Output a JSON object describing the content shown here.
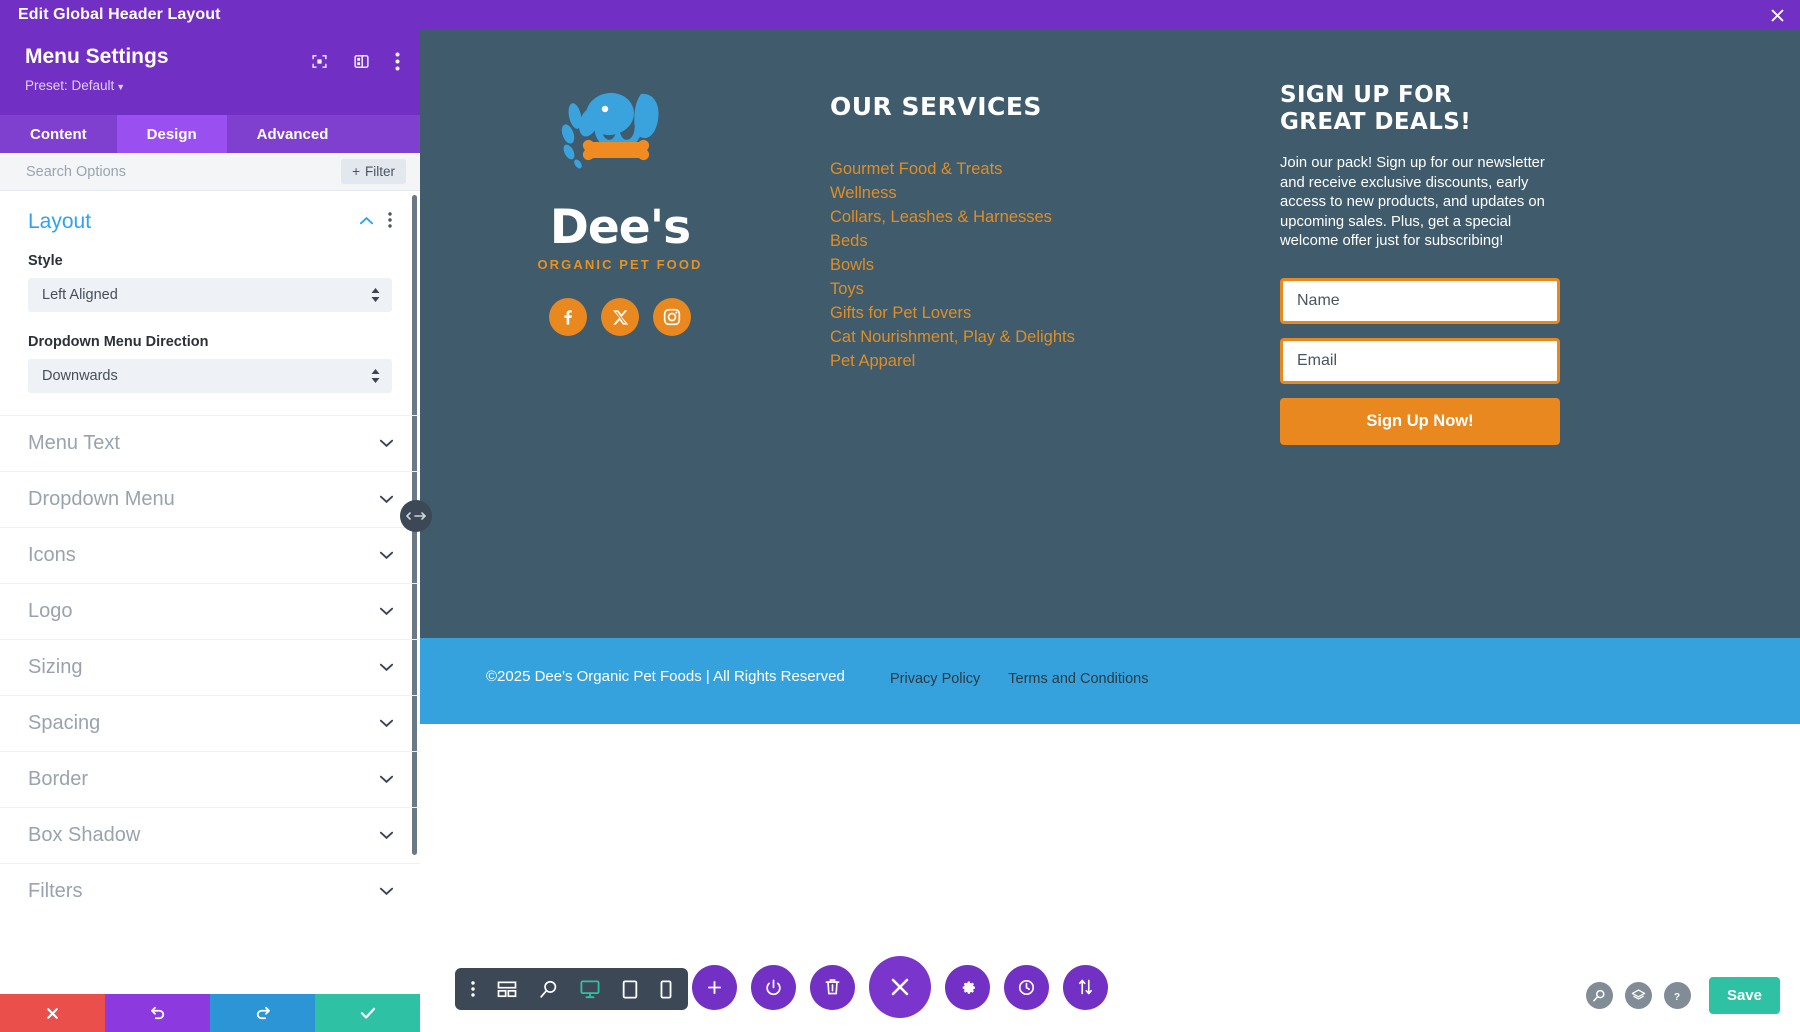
{
  "titlebar": {
    "text": "Edit Global Header Layout",
    "close_icon": "close-icon"
  },
  "panel": {
    "title": "Menu Settings",
    "preset": "Preset: Default",
    "header_icons": [
      "focus-target-icon",
      "panel-layout-icon",
      "more-vertical-icon"
    ],
    "tabs": [
      {
        "label": "Content",
        "active": false
      },
      {
        "label": "Design",
        "active": true
      },
      {
        "label": "Advanced",
        "active": false
      }
    ],
    "search_placeholder": "Search Options",
    "search_value": "",
    "filter_label": "Filter",
    "open_section": {
      "title": "Layout",
      "fields": [
        {
          "label": "Style",
          "value": "Left Aligned"
        },
        {
          "label": "Dropdown Menu Direction",
          "value": "Downwards"
        }
      ]
    },
    "sections": [
      {
        "label": "Menu Text"
      },
      {
        "label": "Dropdown Menu"
      },
      {
        "label": "Icons"
      },
      {
        "label": "Logo"
      },
      {
        "label": "Sizing"
      },
      {
        "label": "Spacing"
      },
      {
        "label": "Border"
      },
      {
        "label": "Box Shadow"
      },
      {
        "label": "Filters"
      }
    ],
    "actions": [
      {
        "name": "cancel-button",
        "icon": "close-icon",
        "color": "#eb4f4b"
      },
      {
        "name": "undo-button",
        "icon": "undo-icon",
        "color": "#8c3ae0"
      },
      {
        "name": "redo-button",
        "icon": "redo-icon",
        "color": "#2b95d6"
      },
      {
        "name": "confirm-button",
        "icon": "check-icon",
        "color": "#2fc1a3"
      }
    ]
  },
  "site": {
    "brand": {
      "word": "Dee's",
      "tagline": "ORGANIC PET FOOD"
    },
    "socials": [
      {
        "name": "facebook-icon"
      },
      {
        "name": "x-twitter-icon"
      },
      {
        "name": "instagram-icon"
      }
    ],
    "services": {
      "heading": "OUR SERVICES",
      "items": [
        "Gourmet Food & Treats",
        "Wellness",
        "Collars, Leashes & Harnesses",
        "Beds",
        "Bowls",
        "Toys",
        "Gifts for Pet Lovers",
        "Cat Nourishment, Play & Delights",
        "Pet Apparel"
      ]
    },
    "signup": {
      "heading": "SIGN UP FOR GREAT DEALS!",
      "body": "Join our pack! Sign up for our newsletter and receive exclusive discounts, early access to new products, and updates on upcoming sales. Plus, get a special welcome offer just for subscribing!",
      "name_placeholder": "Name",
      "name_value": "",
      "email_placeholder": "Email",
      "email_value": "",
      "submit_label": "Sign Up Now!"
    },
    "bottom": {
      "copyright": "©2025 Dee's Organic Pet Foods | All Rights Reserved",
      "links": [
        "Privacy Policy",
        "Terms and Conditions"
      ]
    }
  },
  "builder": {
    "left_tools": [
      {
        "name": "more-vertical-icon"
      },
      {
        "name": "wireframe-icon"
      },
      {
        "name": "zoom-out-icon"
      },
      {
        "name": "desktop-view-icon",
        "active": true
      },
      {
        "name": "tablet-view-icon"
      },
      {
        "name": "phone-view-icon"
      }
    ],
    "center_tools": [
      {
        "name": "add-icon"
      },
      {
        "name": "power-icon"
      },
      {
        "name": "trash-icon"
      },
      {
        "name": "close-builder-icon",
        "primary": true
      },
      {
        "name": "settings-gear-icon"
      },
      {
        "name": "history-clock-icon"
      },
      {
        "name": "sort-arrows-icon"
      }
    ],
    "right_tools": [
      {
        "name": "search-icon"
      },
      {
        "name": "layers-icon"
      },
      {
        "name": "help-icon"
      }
    ],
    "save_label": "Save"
  },
  "colors": {
    "purple": "#7130c3",
    "purple_light": "#9a4ff0",
    "teal_dark": "#3f5b6c",
    "footer_blue": "#35a2dd",
    "orange": "#e8881e",
    "service_orange": "#e08e23",
    "logo_blue": "#3aa3dd",
    "accent_blue": "#2ea3f2",
    "save_green": "#2fc1a3"
  }
}
